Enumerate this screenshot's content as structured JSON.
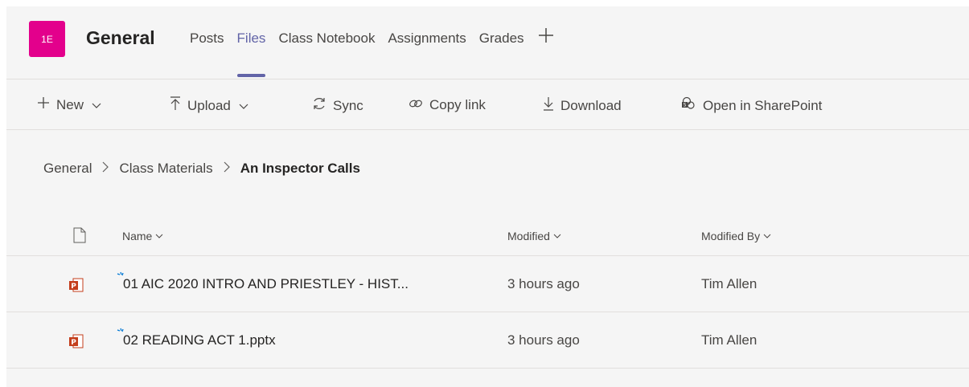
{
  "header": {
    "team_initials": "1E",
    "channel_name": "General",
    "tabs": [
      {
        "label": "Posts",
        "active": false
      },
      {
        "label": "Files",
        "active": true
      },
      {
        "label": "Class Notebook",
        "active": false
      },
      {
        "label": "Assignments",
        "active": false
      },
      {
        "label": "Grades",
        "active": false
      }
    ],
    "add_tab_icon": "plus-icon",
    "accent_color": "#6264a7",
    "avatar_color": "#e3008c"
  },
  "toolbar": {
    "new_label": "New",
    "upload_label": "Upload",
    "sync_label": "Sync",
    "copy_link_label": "Copy link",
    "download_label": "Download",
    "open_sharepoint_label": "Open in SharePoint"
  },
  "breadcrumb": {
    "items": [
      "General",
      "Class Materials"
    ],
    "current": "An Inspector Calls"
  },
  "file_list": {
    "columns": {
      "name": "Name",
      "modified": "Modified",
      "modified_by": "Modified By"
    },
    "rows": [
      {
        "name": "01 AIC 2020 INTRO AND PRIESTLEY - HIST...",
        "modified": "3 hours ago",
        "modified_by": "Tim Allen",
        "icon": "powerpoint-file-icon"
      },
      {
        "name": "02 READING ACT 1.pptx",
        "modified": "3 hours ago",
        "modified_by": "Tim Allen",
        "icon": "powerpoint-file-icon"
      }
    ]
  }
}
